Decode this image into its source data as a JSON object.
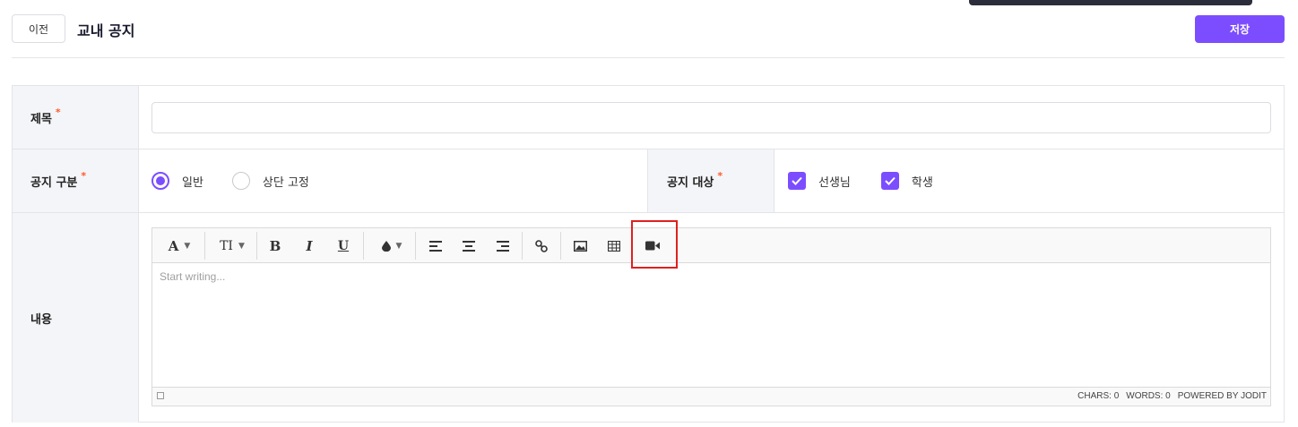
{
  "header": {
    "back_label": "이전",
    "title": "교내 공지",
    "save_label": "저장"
  },
  "form": {
    "title_row": {
      "label": "제목",
      "required_mark": "*",
      "input_value": "",
      "input_placeholder": ""
    },
    "type_row": {
      "label": "공지 구분",
      "required_mark": "*",
      "options": [
        {
          "label": "일반",
          "selected": true
        },
        {
          "label": "상단 고정",
          "selected": false
        }
      ]
    },
    "target_row": {
      "label": "공지 대상",
      "required_mark": "*",
      "options": [
        {
          "label": "선생님",
          "checked": true
        },
        {
          "label": "학생",
          "checked": true
        }
      ]
    },
    "content_row": {
      "label": "내용"
    }
  },
  "editor": {
    "toolbar": {
      "font_icon": "font-icon",
      "font_size_icon": "font-size-icon",
      "bold_icon": "bold-icon",
      "italic_icon": "italic-icon",
      "underline_icon": "underline-icon",
      "color_icon": "color-drop-icon",
      "align_left_icon": "align-left-icon",
      "align_center_icon": "align-center-icon",
      "align_right_icon": "align-right-icon",
      "link_icon": "link-icon",
      "image_icon": "image-icon",
      "table_icon": "table-icon",
      "video_icon": "video-icon"
    },
    "placeholder": "Start writing...",
    "status": {
      "chars": "CHARS: 0",
      "words": "WORDS: 0",
      "powered": "POWERED BY JODIT"
    }
  },
  "colors": {
    "accent": "#7c4dff",
    "required": "#ff5a2a",
    "highlight": "#e02020",
    "label_bg": "#f4f5f8"
  }
}
